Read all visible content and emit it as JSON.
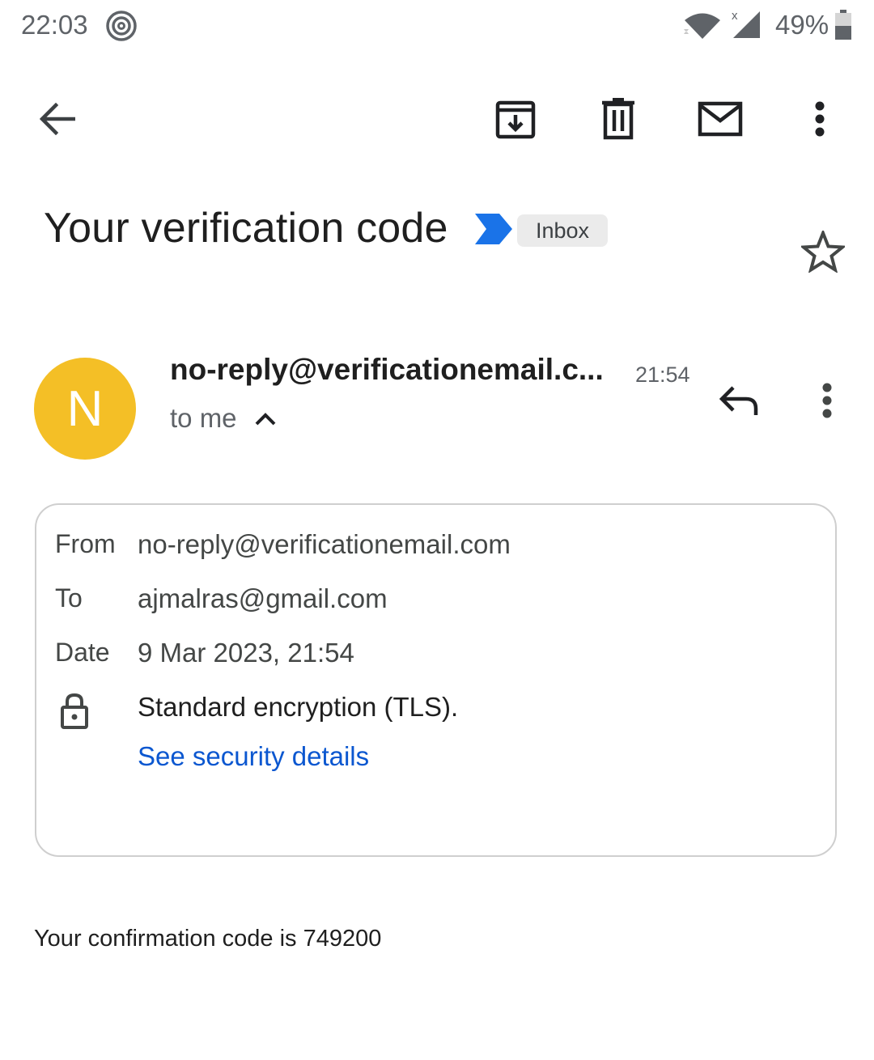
{
  "status_bar": {
    "time": "22:03",
    "battery_percent": "49%",
    "icons": [
      "at-sign-icon",
      "wifi-icon",
      "signal-icon",
      "battery-icon"
    ]
  },
  "toolbar": {
    "icons": [
      "back-arrow-icon",
      "archive-icon",
      "delete-icon",
      "mark-unread-icon",
      "more-vert-icon"
    ]
  },
  "email": {
    "subject": "Your verification code",
    "label": "Inbox",
    "importance_marker_color": "#1a73e8",
    "sender": "no-reply@verificationemail.c...",
    "avatar_letter": "N",
    "avatar_color": "#f4bf26",
    "time": "21:54",
    "recipient_summary": "to me",
    "body": "Your confirmation code is 749200"
  },
  "details": {
    "from_label": "From",
    "from_value": "no-reply@verificationemail.com",
    "to_label": "To",
    "to_value": "ajmalras@gmail.com",
    "date_label": "Date",
    "date_value": "9 Mar 2023, 21:54",
    "encryption_text": "Standard encryption (TLS).",
    "security_link": "See security details"
  }
}
